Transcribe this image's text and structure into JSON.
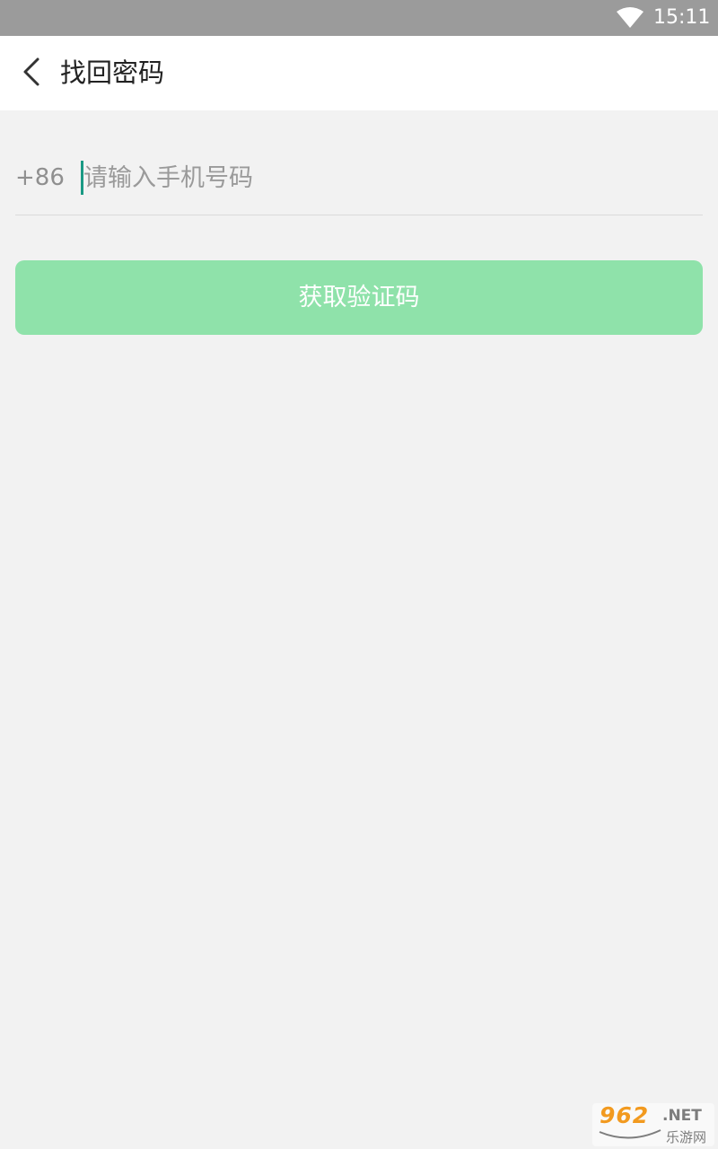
{
  "status_bar": {
    "time": "15:11",
    "wifi_icon": "wifi-icon"
  },
  "header": {
    "title": "找回密码",
    "back_icon": "chevron-left-icon"
  },
  "form": {
    "country_code": "+86",
    "phone": {
      "value": "",
      "placeholder": "请输入手机号码"
    },
    "submit_label": "获取验证码"
  },
  "watermark": {
    "number": "962",
    "suffix": ".NET",
    "name": "乐游网"
  },
  "colors": {
    "status_bar": "#9b9b9b",
    "header_bg": "#ffffff",
    "page_bg": "#f2f2f2",
    "button_bg": "#8fe2aa",
    "caret": "#1a9a84",
    "watermark_accent": "#f29a1f"
  }
}
